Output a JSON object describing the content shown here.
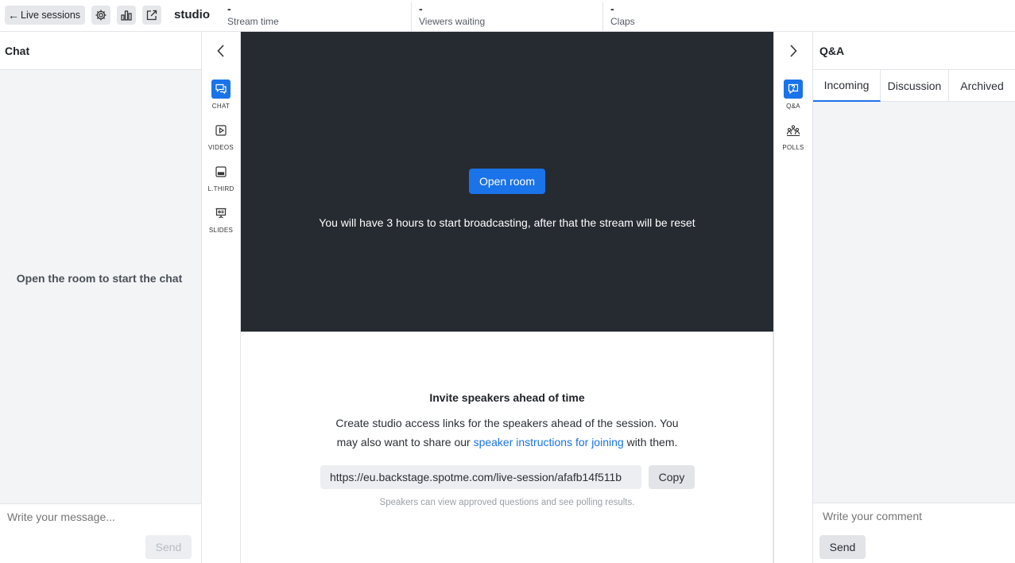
{
  "topbar": {
    "back_label": "Live sessions",
    "title": "studio",
    "icons": [
      "gear-icon",
      "bar-chart-icon",
      "external-link-icon"
    ],
    "stats": [
      {
        "value": "-",
        "label": "Stream time"
      },
      {
        "value": "-",
        "label": "Viewers waiting"
      },
      {
        "value": "-",
        "label": "Claps"
      }
    ]
  },
  "chat": {
    "title": "Chat",
    "empty_message": "Open the room to start the chat",
    "input_placeholder": "Write your message...",
    "send_label": "Send"
  },
  "left_rail": {
    "items": [
      {
        "label": "CHAT",
        "icon": "chat-icon",
        "active": true
      },
      {
        "label": "VIDEOS",
        "icon": "video-icon",
        "active": false
      },
      {
        "label": "L.THIRD",
        "icon": "lower-third-icon",
        "active": false
      },
      {
        "label": "SLIDES",
        "icon": "slides-icon",
        "active": false
      }
    ]
  },
  "stage": {
    "open_room_label": "Open room",
    "note": "You will have 3 hours to start broadcasting, after that the stream will be reset"
  },
  "invite": {
    "title": "Invite speakers ahead of time",
    "desc_before": "Create studio access links for the speakers ahead of the session. You may also want to share our ",
    "desc_link": "speaker instructions for joining",
    "desc_after": " with them.",
    "link_value": "https://eu.backstage.spotme.com/live-session/afafb14f511b",
    "copy_label": "Copy",
    "hint": "Speakers can view approved questions and see polling results."
  },
  "right_rail": {
    "items": [
      {
        "label": "Q&A",
        "icon": "qa-icon",
        "active": true
      },
      {
        "label": "POLLS",
        "icon": "polls-icon",
        "active": false
      }
    ]
  },
  "qa": {
    "title": "Q&A",
    "tabs": [
      {
        "label": "Incoming",
        "active": true
      },
      {
        "label": "Discussion",
        "active": false
      },
      {
        "label": "Archived",
        "active": false
      }
    ],
    "input_placeholder": "Write your comment",
    "send_label": "Send"
  },
  "colors": {
    "accent": "#1a73e8",
    "stage_bg": "#262a31",
    "panel_bg": "#f3f4f6"
  }
}
